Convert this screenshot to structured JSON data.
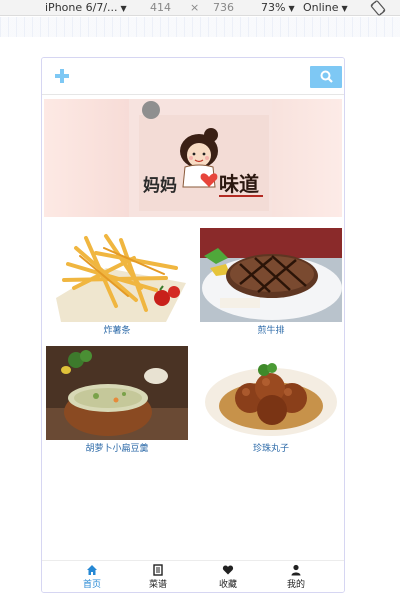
{
  "devtools": {
    "device": "iPhone 6/7/...",
    "width": "414",
    "times": "×",
    "height": "736",
    "zoom": "73%",
    "network": "Online"
  },
  "header": {
    "add_icon": "plus-icon",
    "search_icon": "search-icon",
    "accent": "#7ec8f4"
  },
  "banner": {
    "logo_text_left": "妈妈",
    "logo_text_right": "味道"
  },
  "foods": [
    {
      "label": "炸薯条",
      "image": "fries"
    },
    {
      "label": "煎牛排",
      "image": "steak"
    },
    {
      "label": "胡萝卜小扁豆羹",
      "image": "soup"
    },
    {
      "label": "珍珠丸子",
      "image": "meatballs"
    }
  ],
  "tabs": [
    {
      "label": "首页",
      "icon": "home-icon",
      "active": true
    },
    {
      "label": "菜谱",
      "icon": "book-icon",
      "active": false
    },
    {
      "label": "收藏",
      "icon": "heart-icon",
      "active": false
    },
    {
      "label": "我的",
      "icon": "user-icon",
      "active": false
    }
  ],
  "colors": {
    "link": "#2c6aa8",
    "active_tab": "#2688d4"
  }
}
